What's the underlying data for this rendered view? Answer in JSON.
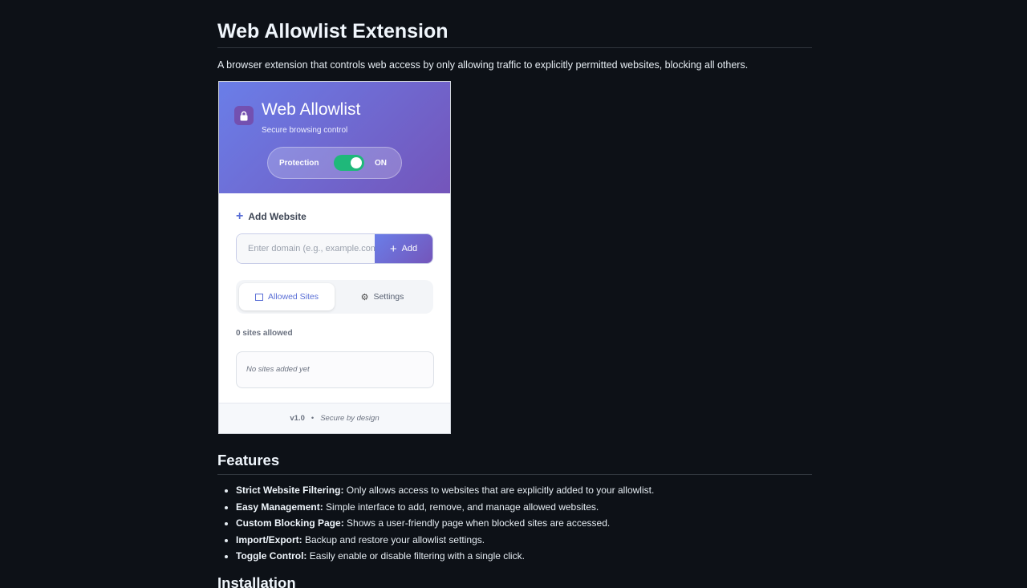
{
  "page": {
    "title": "Web Allowlist Extension",
    "intro": "A browser extension that controls web access by only allowing traffic to explicitly permitted websites, blocking all others."
  },
  "extension": {
    "title": "Web Allowlist",
    "subtitle": "Secure browsing control",
    "protection_label": "Protection",
    "protection_state": "ON",
    "protection_enabled": true,
    "add_section_label": "Add Website",
    "domain_placeholder": "Enter domain (e.g., example.com)",
    "add_button_label": "Add",
    "tabs": [
      {
        "label": "Allowed Sites",
        "active": true
      },
      {
        "label": "Settings",
        "active": false
      }
    ],
    "sites_count": "0 sites allowed",
    "empty_message": "No sites added yet",
    "footer_version": "v1.0",
    "footer_separator": "•",
    "footer_tagline": "Secure by design",
    "colors": {
      "header_gradient_start": "#6a7ee8",
      "header_gradient_end": "#7455ba",
      "toggle_on": "#1fb87a"
    }
  },
  "features": {
    "heading": "Features",
    "items": [
      {
        "name": "Strict Website Filtering:",
        "desc": " Only allows access to websites that are explicitly added to your allowlist."
      },
      {
        "name": "Easy Management:",
        "desc": " Simple interface to add, remove, and manage allowed websites."
      },
      {
        "name": "Custom Blocking Page:",
        "desc": " Shows a user-friendly page when blocked sites are accessed."
      },
      {
        "name": "Import/Export:",
        "desc": " Backup and restore your allowlist settings."
      },
      {
        "name": "Toggle Control:",
        "desc": " Easily enable or disable filtering with a single click."
      }
    ]
  },
  "installation": {
    "heading": "Installation"
  }
}
